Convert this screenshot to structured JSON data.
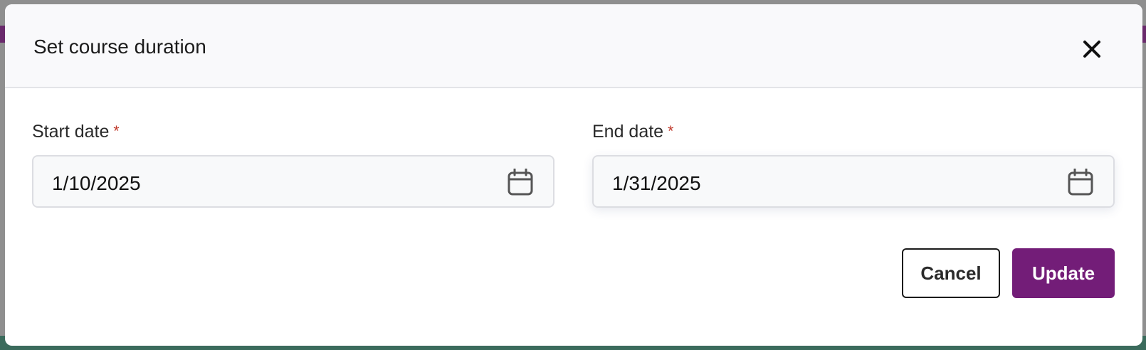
{
  "dialog": {
    "title": "Set course duration",
    "close_icon": "close-icon"
  },
  "fields": {
    "start": {
      "label": "Start date",
      "required_marker": "*",
      "value": "1/10/2025",
      "icon": "calendar-icon"
    },
    "end": {
      "label": "End date",
      "required_marker": "*",
      "value": "1/31/2025",
      "icon": "calendar-icon"
    }
  },
  "actions": {
    "cancel_label": "Cancel",
    "update_label": "Update"
  },
  "colors": {
    "accent": "#731d78",
    "required": "#c0392b",
    "header_bg": "#f9f9fb"
  }
}
